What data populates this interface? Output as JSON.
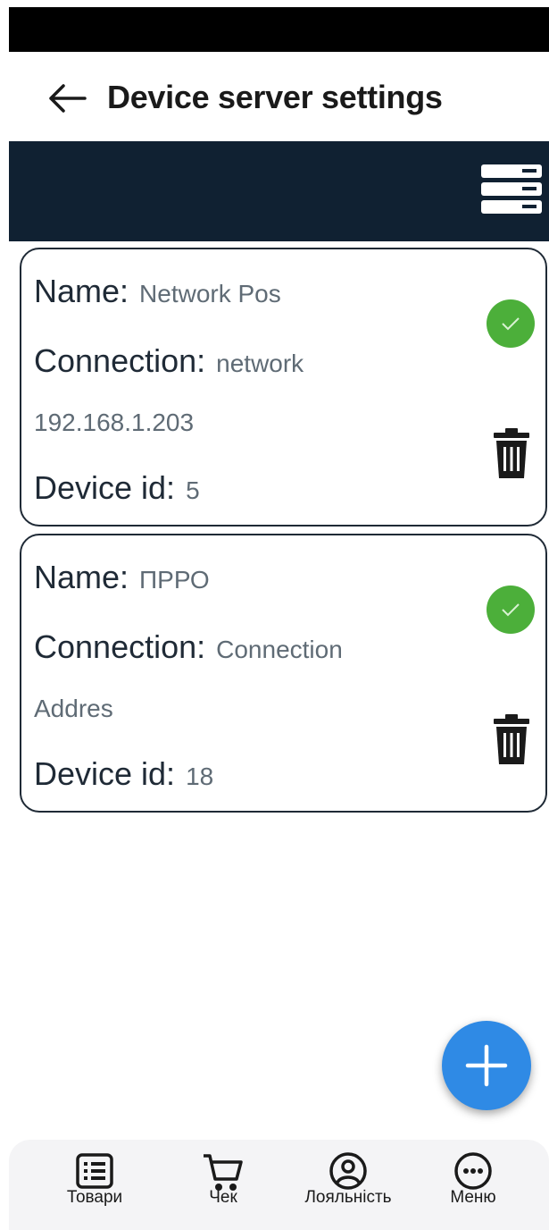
{
  "header": {
    "title": "Device server settings"
  },
  "devices": [
    {
      "name_label": "Name:",
      "name": "Network Pos",
      "connection_label": "Connection:",
      "connection": "network",
      "address": "192.168.1.203",
      "device_id_label": "Device id:",
      "device_id": "5",
      "status": "active"
    },
    {
      "name_label": "Name:",
      "name": "ПРРО",
      "connection_label": "Connection:",
      "connection": "Connection",
      "address": "Addres",
      "device_id_label": "Device id:",
      "device_id": "18",
      "status": "active"
    }
  ],
  "nav": {
    "items": [
      {
        "label": "Товари",
        "icon": "list-icon"
      },
      {
        "label": "Чек",
        "icon": "cart-icon"
      },
      {
        "label": "Лояльність",
        "icon": "user-circle-icon"
      },
      {
        "label": "Меню",
        "icon": "more-icon"
      }
    ]
  },
  "colors": {
    "banner": "#102132",
    "success": "#4caf3a",
    "fab": "#2f8ae5"
  }
}
